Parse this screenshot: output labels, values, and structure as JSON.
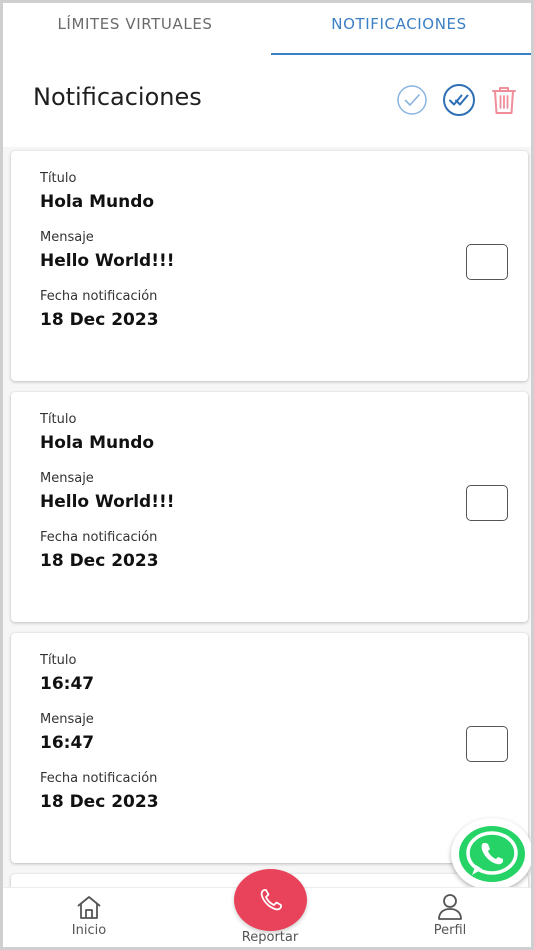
{
  "tabs": [
    {
      "label": "LÍMITES VIRTUALES",
      "active": false
    },
    {
      "label": "NOTIFICACIONES",
      "active": true
    }
  ],
  "header": {
    "title": "Notificaciones",
    "actions": [
      "check-circle-icon",
      "double-check-circle-icon",
      "trash-icon"
    ]
  },
  "notifications": [
    {
      "title_label": "Título",
      "title": "Hola Mundo",
      "message_label": "Mensaje",
      "message": "Hello World!!!",
      "date_label": "Fecha notificación",
      "date": "18 Dec 2023",
      "checked": false
    },
    {
      "title_label": "Título",
      "title": "Hola Mundo",
      "message_label": "Mensaje",
      "message": "Hello World!!!",
      "date_label": "Fecha notificación",
      "date": "18 Dec 2023",
      "checked": false
    },
    {
      "title_label": "Título",
      "title": "16:47",
      "message_label": "Mensaje",
      "message": "16:47",
      "date_label": "Fecha notificación",
      "date": "18 Dec 2023",
      "checked": false
    }
  ],
  "bottom_nav": {
    "home_label": "Inicio",
    "report_label": "Reportar",
    "profile_label": "Perfil"
  },
  "colors": {
    "accent": "#3b7fc4",
    "danger": "#e8435a",
    "whatsapp": "#25d366"
  }
}
